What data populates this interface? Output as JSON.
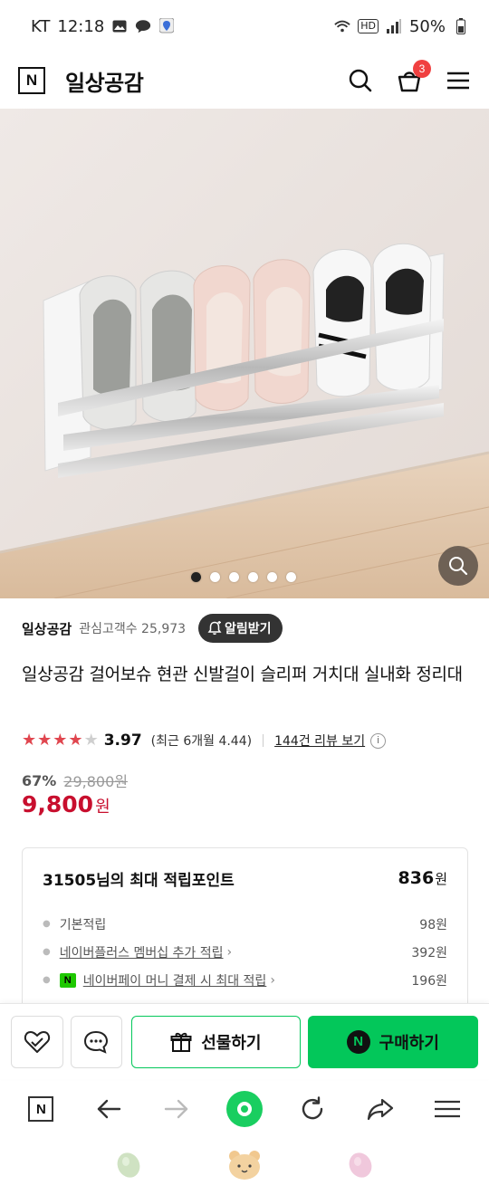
{
  "status_bar": {
    "carrier": "KT",
    "time": "12:18",
    "battery": "50%",
    "hd": "HD"
  },
  "header": {
    "logo": "N",
    "title": "일상공감",
    "cart_count": "3"
  },
  "hero": {
    "slides_total": 6,
    "active_slide": 1
  },
  "seller": {
    "name": "일상공감",
    "interest_label": "관심고객수 25,973",
    "alarm_label": "알림받기"
  },
  "product": {
    "title": "일상공감 걸어보슈 현관 신발걸이 슬리퍼 거치대 실내화 정리대",
    "rating": "3.97",
    "rating_value": 3.97,
    "recent_rating": "(최근 6개월 4.44)",
    "review_link": "144건 리뷰 보기",
    "discount": "67%",
    "original_price": "29,800원",
    "price": "9,800",
    "price_unit": "원"
  },
  "points": {
    "title": "31505님의 최대 적립포인트",
    "total": "836",
    "total_unit": "원",
    "items": [
      {
        "label": "기본적립",
        "value": "98원",
        "link": false
      },
      {
        "label": "네이버플러스 멤버십 추가 적립",
        "value": "392원",
        "link": true
      },
      {
        "label": "네이버페이 머니 결제 시 최대 적립",
        "value": "196원",
        "link": true,
        "npay": "N"
      }
    ]
  },
  "actions": {
    "gift_label": "선물하기",
    "buy_label": "구매하기",
    "buy_logo": "N"
  },
  "colors": {
    "naver_green": "#03c75a",
    "price_red": "#c80f2e",
    "badge_red": "#f04040"
  },
  "icons": [
    "search-icon",
    "cart-icon",
    "menu-icon",
    "zoom-icon",
    "bell-icon",
    "heart-icon",
    "talk-icon",
    "gift-icon",
    "back-icon",
    "forward-icon",
    "refresh-icon",
    "share-icon"
  ]
}
